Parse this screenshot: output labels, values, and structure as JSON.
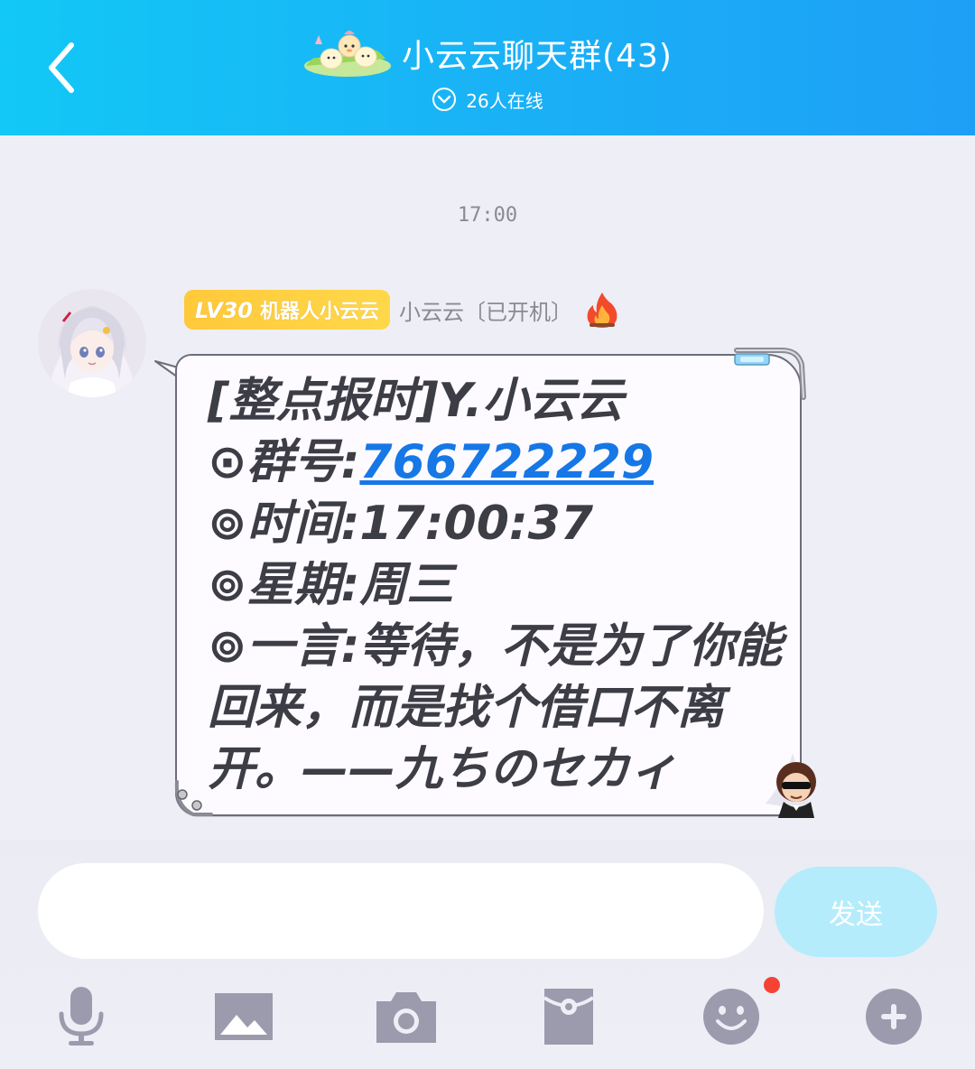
{
  "header": {
    "title": "小云云聊天群(43)",
    "online": "26人在线",
    "back_icon": "chevron-left-icon",
    "online_icon": "chevron-down-circle-icon"
  },
  "chat": {
    "timestamp": "17:00",
    "message": {
      "badge_level": "LV30",
      "badge_title": "机器人小云云",
      "nickname": "小云云〔已开机〕",
      "lines": {
        "l1": "[整点报时]Y.小云云",
        "l2_prefix": "⊙群号:",
        "l2_link": "766722229",
        "l3": "⊚时间:17:00:37",
        "l4": "⊚星期:周三",
        "l5": "⊚一言:等待，不是为了你能回来，而是找个借口不离开。——九ちのセカィ"
      }
    }
  },
  "input": {
    "placeholder": "",
    "send_label": "发送"
  },
  "toolbar": {
    "icons": [
      "microphone-icon",
      "image-icon",
      "camera-icon",
      "red-packet-icon",
      "emoji-icon",
      "plus-icon"
    ]
  },
  "colors": {
    "header_start": "#12c8f6",
    "header_end": "#1e9ff6",
    "link": "#1677e6",
    "send_button": "#b4ecfb",
    "badge": "#ffc93a",
    "notification_dot": "#f44336",
    "icon_gray": "#9b9bad"
  }
}
